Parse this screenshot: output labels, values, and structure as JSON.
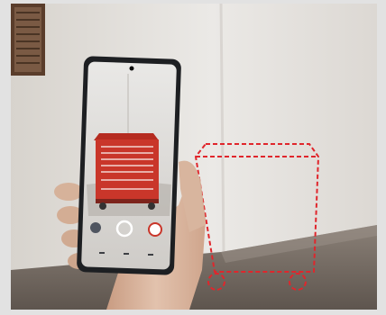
{
  "scene": {
    "subject": "augmented-reality-toolbox-placement-on-smartphone",
    "colors": {
      "wall": "#e6e4e1",
      "floor": "#7b7168",
      "toolbox": "#c9362a",
      "outline": "#e0262c",
      "skin": "#d8b59e",
      "phone_body": "#1d1f22"
    },
    "icons": [
      "camera-shutter-icon",
      "gallery-icon",
      "ar-object-icon"
    ]
  }
}
